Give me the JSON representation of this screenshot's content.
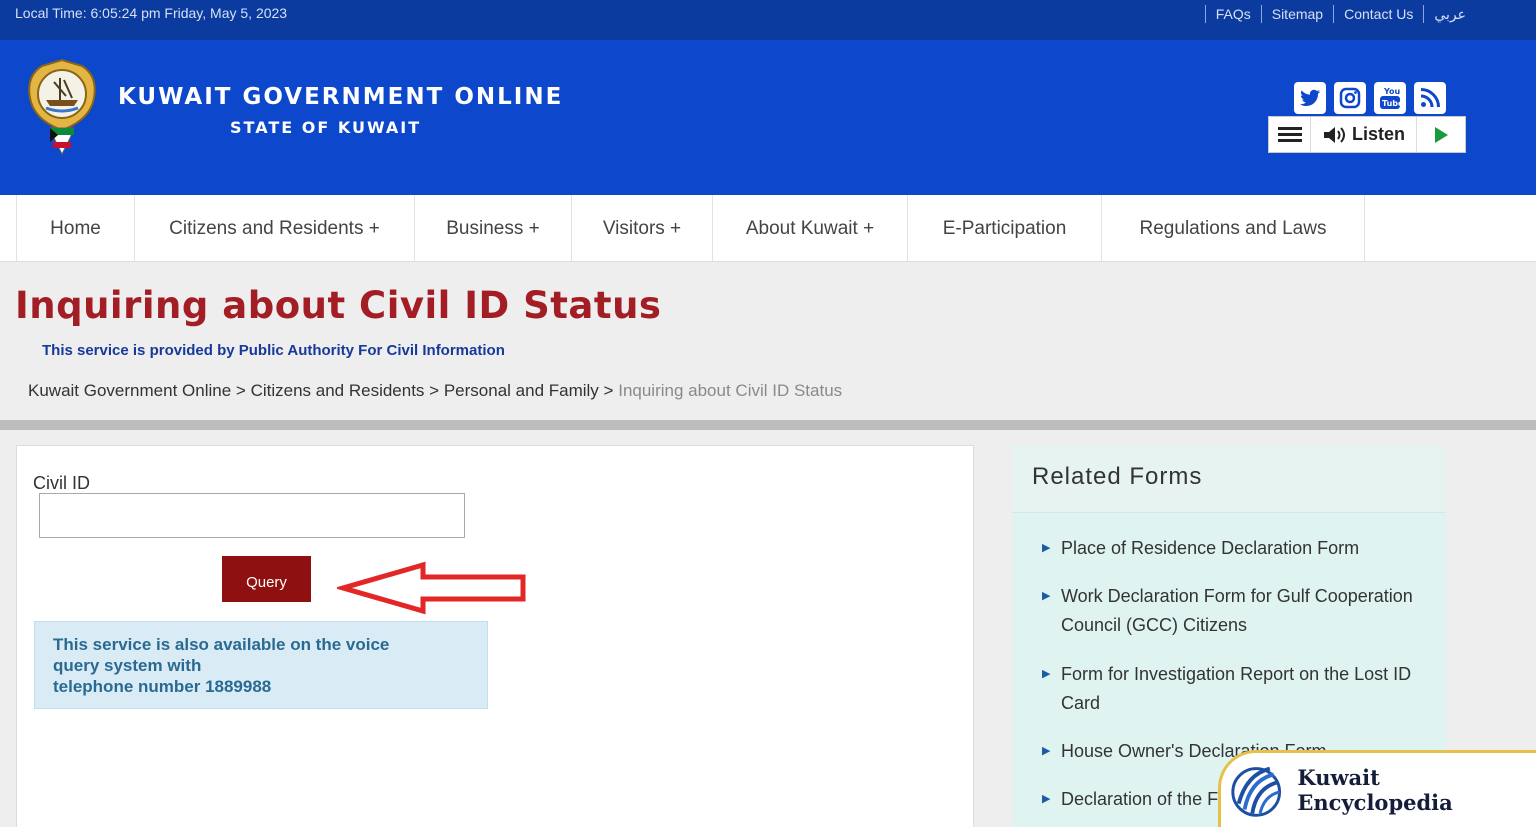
{
  "topbar": {
    "local_time": "Local Time: 6:05:24 pm Friday, May 5, 2023",
    "links": [
      "FAQs",
      "Sitemap",
      "Contact Us",
      "عربي"
    ]
  },
  "header": {
    "title": "KUWAIT GOVERNMENT ONLINE",
    "subtitle": "STATE OF KUWAIT",
    "social_icons": [
      "twitter-icon",
      "instagram-icon",
      "youtube-icon",
      "rss-icon"
    ],
    "listen_label": "Listen"
  },
  "nav": {
    "items": [
      {
        "label": "Home"
      },
      {
        "label": "Citizens and Residents +"
      },
      {
        "label": "Business +"
      },
      {
        "label": "Visitors +"
      },
      {
        "label": "About Kuwait +"
      },
      {
        "label": "E-Participation"
      },
      {
        "label": "Regulations and Laws"
      }
    ]
  },
  "page": {
    "title": "Inquiring about Civil ID Status",
    "provider": "This service is provided by Public Authority For Civil Information",
    "breadcrumb": [
      "Kuwait Government Online",
      "Citizens and Residents",
      "Personal and Family",
      "Inquiring about Civil ID Status"
    ],
    "breadcrumb_separator": ">"
  },
  "form": {
    "civil_id_label": "Civil ID",
    "civil_id_value": "",
    "query_label": "Query",
    "info_lines": [
      "This service is also available on the voice",
      "query system with",
      "telephone number 1889988"
    ]
  },
  "related_forms": {
    "title": "Related Forms",
    "items": [
      {
        "label": "Place of Residence Declaration Form"
      },
      {
        "label": "Work Declaration Form for Gulf Cooperation Council (GCC) Citizens"
      },
      {
        "label": "Form for Investigation Report on the Lost ID Card"
      },
      {
        "label": "House Owner's Declaration Form"
      },
      {
        "label": "Declaration of the F"
      }
    ]
  },
  "watermark": {
    "name": "Kuwait Encyclopedia"
  },
  "colors": {
    "topbar": "#0b3b9e",
    "header": "#0d47cc",
    "title_red": "#a31d24",
    "query_button": "#8f1010",
    "arrow_red": "#e32626"
  }
}
